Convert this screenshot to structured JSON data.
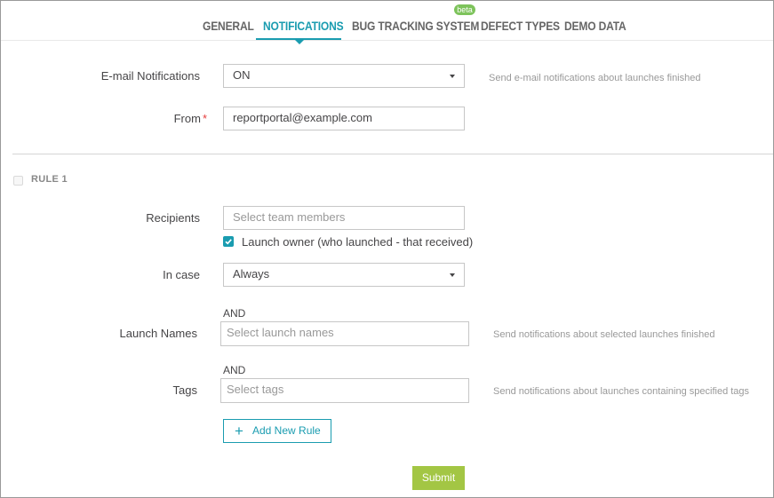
{
  "tabs": [
    {
      "label": "GENERAL"
    },
    {
      "label": "NOTIFICATIONS",
      "active": true
    },
    {
      "label": "BUG TRACKING SYSTEM",
      "badge": "beta"
    },
    {
      "label": "DEFECT TYPES"
    },
    {
      "label": "DEMO DATA"
    }
  ],
  "email": {
    "label": "E-mail Notifications",
    "value": "ON",
    "hint": "Send e-mail notifications about launches finished"
  },
  "from": {
    "label": "From",
    "required_mark": "*",
    "value": "reportportal@example.com"
  },
  "rule": {
    "title": "RULE 1",
    "recipients": {
      "label": "Recipients",
      "placeholder": "Select team members",
      "launch_owner_label": "Launch owner (who launched - that received)",
      "launch_owner_checked": true
    },
    "in_case": {
      "label": "In case",
      "value": "Always"
    },
    "launch_names": {
      "and_label": "AND",
      "label": "Launch Names",
      "placeholder": "Select launch names",
      "hint": "Send notifications about selected launches finished"
    },
    "tags": {
      "and_label": "AND",
      "label": "Tags",
      "placeholder": "Select tags",
      "hint": "Send notifications about launches containing specified tags"
    }
  },
  "actions": {
    "add_rule_icon": "plus-icon",
    "add_rule_label": "Add New Rule",
    "submit_label": "Submit"
  },
  "colors": {
    "accent": "#1a9cb0",
    "submit": "#a3c644",
    "beta_badge": "#7dc35b",
    "required": "#e53c3c"
  }
}
